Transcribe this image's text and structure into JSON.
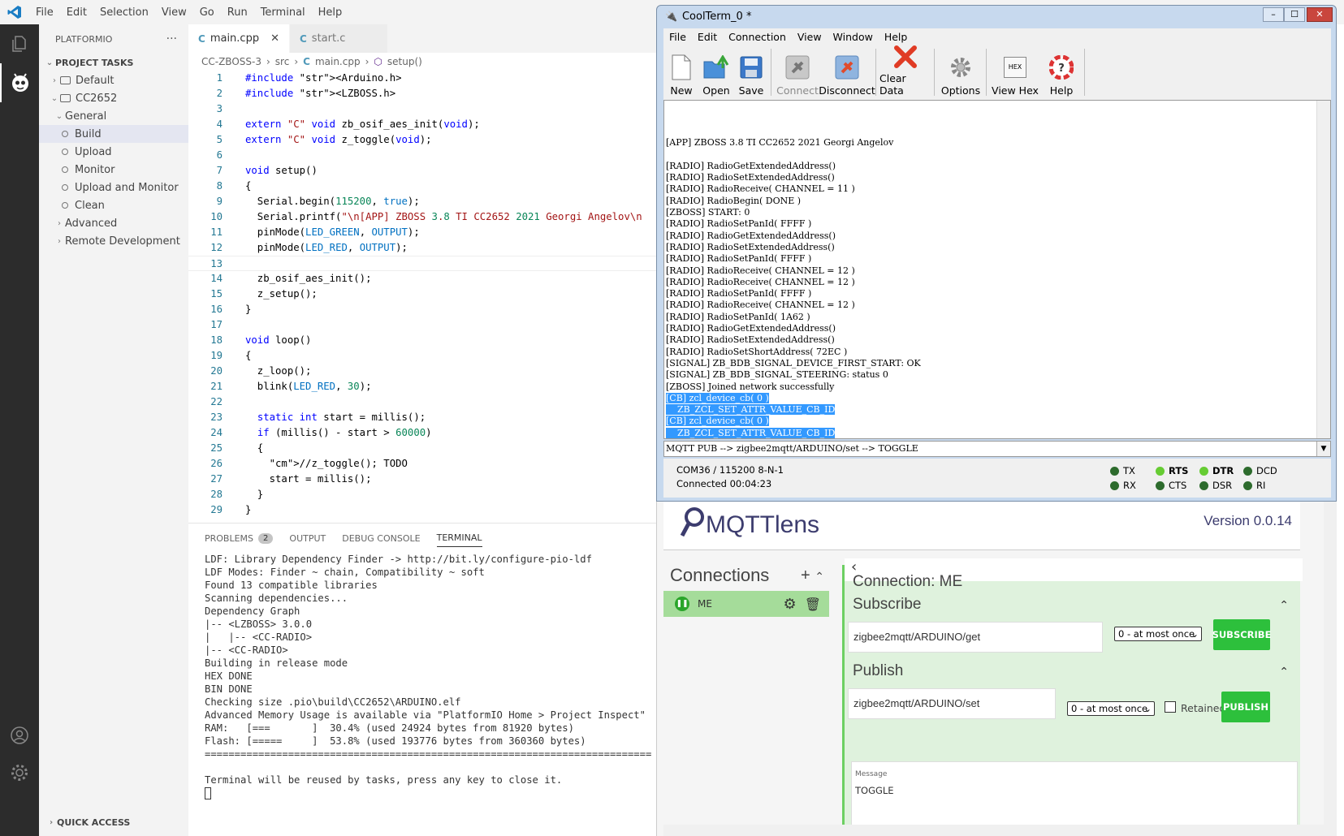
{
  "vscode": {
    "menu": [
      "File",
      "Edit",
      "Selection",
      "View",
      "Go",
      "Run",
      "Terminal",
      "Help"
    ],
    "sidebar": {
      "title": "PLATFORMIO",
      "section": "PROJECT TASKS",
      "items": [
        {
          "label": "Default"
        },
        {
          "label": "CC2652"
        },
        {
          "label": "General"
        },
        {
          "label": "Build"
        },
        {
          "label": "Upload"
        },
        {
          "label": "Monitor"
        },
        {
          "label": "Upload and Monitor"
        },
        {
          "label": "Clean"
        },
        {
          "label": "Advanced"
        },
        {
          "label": "Remote Development"
        }
      ],
      "quick_access": "QUICK ACCESS"
    },
    "tabs": [
      {
        "icon": "C",
        "label": "main.cpp"
      },
      {
        "icon": "C",
        "label": "start.c"
      }
    ],
    "breadcrumb": [
      "CC-ZBOSS-3",
      "src",
      "main.cpp",
      "setup()"
    ],
    "code": [
      "#include <Arduino.h>",
      "#include <LZBOSS.h>",
      "",
      "extern \"C\" void zb_osif_aes_init(void);",
      "extern \"C\" void z_toggle(void);",
      "",
      "void setup()",
      "{",
      "  Serial.begin(115200, true);",
      "  Serial.printf(\"\\n[APP] ZBOSS 3.8 TI CC2652 2021 Georgi Angelov\\n",
      "  pinMode(LED_GREEN, OUTPUT);",
      "  pinMode(LED_RED, OUTPUT);",
      "",
      "  zb_osif_aes_init();",
      "  z_setup();",
      "}",
      "",
      "void loop()",
      "{",
      "  z_loop();",
      "  blink(LED_RED, 30);",
      "",
      "  static int start = millis();",
      "  if (millis() - start > 60000)",
      "  {",
      "    //z_toggle(); TODO",
      "    start = millis();",
      "  }",
      "}"
    ],
    "panel_tabs": [
      {
        "label": "PROBLEMS",
        "badge": "2"
      },
      {
        "label": "OUTPUT"
      },
      {
        "label": "DEBUG CONSOLE"
      },
      {
        "label": "TERMINAL"
      }
    ],
    "terminal": [
      "LDF: Library Dependency Finder -> http://bit.ly/configure-pio-ldf",
      "LDF Modes: Finder ~ chain, Compatibility ~ soft",
      "Found 13 compatible libraries",
      "Scanning dependencies...",
      "Dependency Graph",
      "|-- <LZBOSS> 3.0.0",
      "|   |-- <CC-RADIO>",
      "|-- <CC-RADIO>",
      "Building in release mode",
      "HEX DONE",
      "BIN DONE",
      "Checking size .pio\\build\\CC2652\\ARDUINO.elf",
      "Advanced Memory Usage is available via \"PlatformIO Home > Project Inspect\"",
      "RAM:   [===       ]  30.4% (used 24924 bytes from 81920 bytes)",
      "Flash: [=====     ]  53.8% (used 193776 bytes from 360360 bytes)",
      "===========================================================================",
      "",
      "Terminal will be reused by tasks, press any key to close it."
    ]
  },
  "coolterm": {
    "title": "CoolTerm_0 *",
    "menu": [
      "File",
      "Edit",
      "Connection",
      "View",
      "Window",
      "Help"
    ],
    "toolbar": [
      {
        "label": "New",
        "icon": "new-icon"
      },
      {
        "label": "Open",
        "icon": "open-icon"
      },
      {
        "label": "Save",
        "icon": "save-icon"
      },
      {
        "label": "Connect",
        "icon": "connect-icon"
      },
      {
        "label": "Disconnect",
        "icon": "disconnect-icon"
      },
      {
        "label": "Clear Data",
        "icon": "clear-icon"
      },
      {
        "label": "Options",
        "icon": "gear-icon"
      },
      {
        "label": "View Hex",
        "icon": "hex-icon"
      },
      {
        "label": "Help",
        "icon": "help-icon"
      }
    ],
    "hex_icon_text": "HEX",
    "output": [
      "",
      "[APP] ZBOSS 3.8 TI CC2652 2021 Georgi Angelov",
      "",
      "[RADIO] RadioGetExtendedAddress()",
      "[RADIO] RadioSetExtendedAddress()",
      "[RADIO] RadioReceive( CHANNEL = 11 )",
      "[RADIO] RadioBegin( DONE )",
      "[ZBOSS] START: 0",
      "[RADIO] RadioSetPanId( FFFF )",
      "[RADIO] RadioGetExtendedAddress()",
      "[RADIO] RadioSetExtendedAddress()",
      "[RADIO] RadioSetPanId( FFFF )",
      "[RADIO] RadioReceive( CHANNEL = 12 )",
      "[RADIO] RadioReceive( CHANNEL = 12 )",
      "[RADIO] RadioSetPanId( FFFF )",
      "[RADIO] RadioReceive( CHANNEL = 12 )",
      "[RADIO] RadioSetPanId( 1A62 )",
      "[RADIO] RadioGetExtendedAddress()",
      "[RADIO] RadioSetExtendedAddress()",
      "[RADIO] RadioSetShortAddress( 72EC )",
      "[SIGNAL] ZB_BDB_SIGNAL_DEVICE_FIRST_START: OK",
      "[SIGNAL] ZB_BDB_SIGNAL_STEERING: status 0",
      "[ZBOSS] Joined network successfully"
    ],
    "selected": [
      "[CB] zcl_device_cb( 0 )",
      "    ZB_ZCL_SET_ATTR_VALUE_CB_ID",
      "[CB] zcl_device_cb( 0 )",
      "    ZB_ZCL_SET_ATTR_VALUE_CB_ID"
    ],
    "input": "MQTT PUB --> zigbee2mqtt/ARDUINO/set --> TOGGLE",
    "port": "COM36 / 115200 8-N-1",
    "connected": "Connected 00:04:23",
    "leds": {
      "tx": "TX",
      "rx": "RX",
      "rts": "RTS",
      "cts": "CTS",
      "dtr": "DTR",
      "dsr": "DSR",
      "dcd": "DCD",
      "ri": "RI"
    }
  },
  "mqttlens": {
    "logo": "MQTTlens",
    "version": "Version 0.0.14",
    "connections_title": "Connections",
    "connection_name": "ME",
    "connection_title": "Connection: ME",
    "subscribe_title": "Subscribe",
    "subscribe_topic": "zigbee2mqtt/ARDUINO/get",
    "qos": "0 - at most once",
    "subscribe_button": "SUBSCRIBE",
    "publish_title": "Publish",
    "publish_topic": "zigbee2mqtt/ARDUINO/set",
    "retained": "Retained",
    "publish_button": "PUBLISH",
    "message_label": "Message",
    "message": "TOGGLE"
  }
}
